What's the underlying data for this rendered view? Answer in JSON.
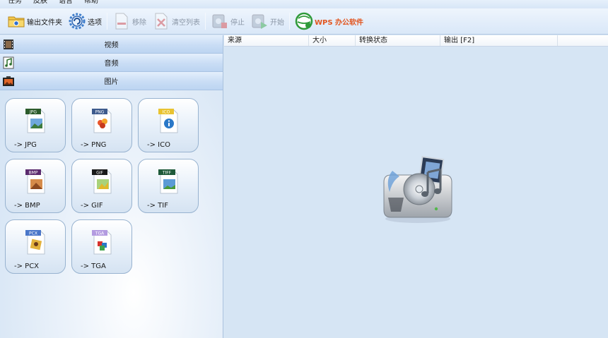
{
  "menu": [
    "任务",
    "皮肤",
    "语言",
    "帮助"
  ],
  "toolbar": {
    "output_folder": "输出文件夹",
    "options": "选项",
    "remove": "移除",
    "clear_list": "清空列表",
    "stop": "停止",
    "start": "开始",
    "wps": "WPS 办公软件"
  },
  "categories": {
    "video": "视频",
    "audio": "音频",
    "picture": "图片"
  },
  "formats": [
    {
      "badge": "JPG",
      "label": "-> JPG",
      "badge_color": "#2b5b2b"
    },
    {
      "badge": "PNG",
      "label": "-> PNG",
      "badge_color": "#3d5a8c"
    },
    {
      "badge": "ICO",
      "label": "-> ICO",
      "badge_color": "#e9c331"
    },
    {
      "badge": "BMP",
      "label": "-> BMP",
      "badge_color": "#5b2a6e"
    },
    {
      "badge": "GIF",
      "label": "-> GIF",
      "badge_color": "#1a1a1a"
    },
    {
      "badge": "TIFF",
      "label": "-> TIF",
      "badge_color": "#1f5a3a"
    },
    {
      "badge": "PCX",
      "label": "-> PCX",
      "badge_color": "#4a76c9"
    },
    {
      "badge": "TGA",
      "label": "-> TGA",
      "badge_color": "#b39be0"
    }
  ],
  "columns": [
    "来源",
    "大小",
    "转换状态",
    "输出 [F2]"
  ],
  "colors": {
    "accent": "#d6e5f4",
    "wps": "#e2551f",
    "disabled_text": "#8a96a6"
  }
}
